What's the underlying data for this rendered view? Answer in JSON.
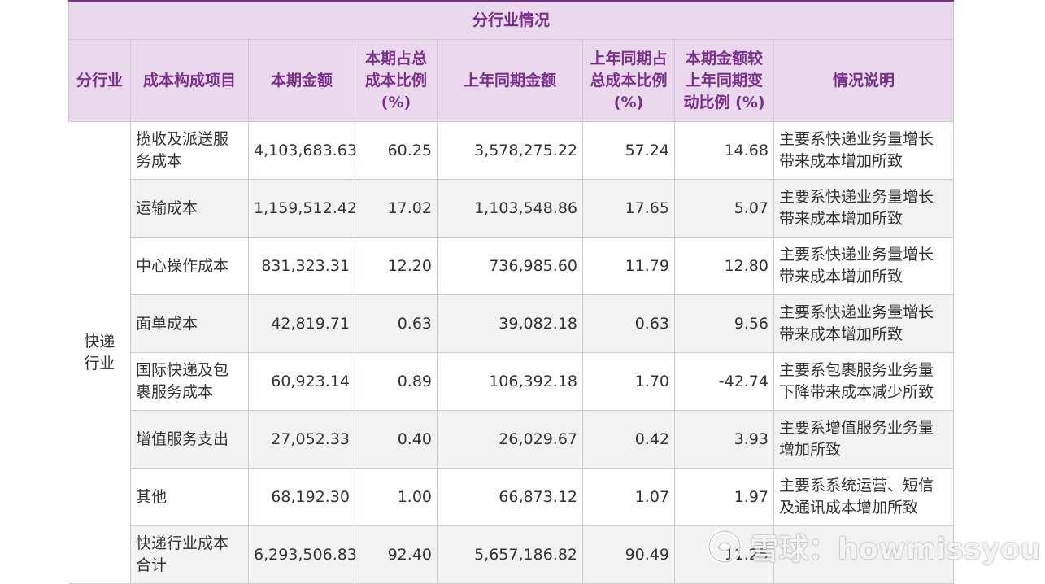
{
  "table": {
    "title": "分行业情况",
    "headers": [
      "分行业",
      "成本构成项目",
      "本期金额",
      "本期占总成本比例 (%)",
      "上年同期金额",
      "上年同期占总成本比例 (%)",
      "本期金额较上年同期变动比例 (%)",
      "情况说明"
    ],
    "industry": "快递行业",
    "rows": [
      {
        "item": "揽收及派送服务成本",
        "current": "4,103,683.63",
        "current_pct": "60.25",
        "prior": "3,578,275.22",
        "prior_pct": "57.24",
        "change": "14.68",
        "note": "主要系快递业务量增长带来成本增加所致"
      },
      {
        "item": "运输成本",
        "current": "1,159,512.42",
        "current_pct": "17.02",
        "prior": "1,103,548.86",
        "prior_pct": "17.65",
        "change": "5.07",
        "note": "主要系快递业务量增长带来成本增加所致"
      },
      {
        "item": "中心操作成本",
        "current": "831,323.31",
        "current_pct": "12.20",
        "prior": "736,985.60",
        "prior_pct": "11.79",
        "change": "12.80",
        "note": "主要系快递业务量增长带来成本增加所致"
      },
      {
        "item": "面单成本",
        "current": "42,819.71",
        "current_pct": "0.63",
        "prior": "39,082.18",
        "prior_pct": "0.63",
        "change": "9.56",
        "note": "主要系快递业务量增长带来成本增加所致"
      },
      {
        "item": "国际快递及包裹服务成本",
        "current": "60,923.14",
        "current_pct": "0.89",
        "prior": "106,392.18",
        "prior_pct": "1.70",
        "change": "-42.74",
        "note": "主要系包裹服务业务量下降带来成本减少所致"
      },
      {
        "item": "增值服务支出",
        "current": "27,052.33",
        "current_pct": "0.40",
        "prior": "26,029.67",
        "prior_pct": "0.42",
        "change": "3.93",
        "note": "主要系增值服务业务量增加所致"
      },
      {
        "item": "其他",
        "current": "68,192.30",
        "current_pct": "1.00",
        "prior": "66,873.12",
        "prior_pct": "1.07",
        "change": "1.97",
        "note": "主要系系统运营、短信及通讯成本增加所致"
      },
      {
        "item": "快递行业成本合计",
        "current": "6,293,506.83",
        "current_pct": "92.40",
        "prior": "5,657,186.82",
        "prior_pct": "90.49",
        "change": "11.25",
        "note": ""
      }
    ]
  },
  "watermark": {
    "text": "雪球：howmissyou",
    "icon": "snowball-logo-icon"
  }
}
